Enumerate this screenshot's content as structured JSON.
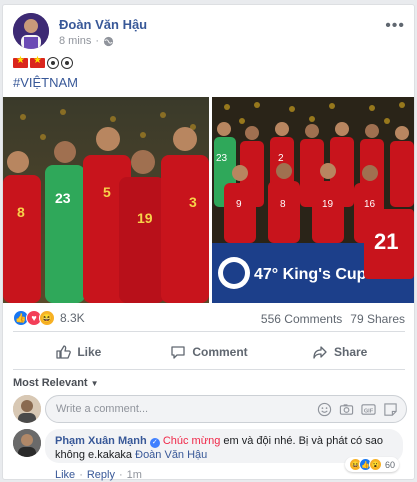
{
  "post": {
    "author": "Đoàn Văn Hậu",
    "time": "8 mins",
    "privacy_icon": "globe-icon",
    "hashtag": "#VIỆTNAM",
    "emoji_line": [
      "vietnam-flag",
      "vietnam-flag",
      "soccer-ball",
      "soccer-ball"
    ]
  },
  "photos": {
    "left_numbers": [
      "8",
      "23",
      "5",
      "19",
      "3"
    ],
    "right_numbers": [
      "23",
      "2",
      "9",
      "8",
      "19",
      "16",
      "21"
    ],
    "banner_text": "47° King's Cup"
  },
  "stats": {
    "reactions": [
      "like",
      "love",
      "haha"
    ],
    "reaction_count": "8.3K",
    "comments": "556 Comments",
    "shares": "79 Shares"
  },
  "actions": {
    "like": "Like",
    "comment": "Comment",
    "share": "Share"
  },
  "comments_section": {
    "sort": "Most Relevant",
    "placeholder": "Write a comment...",
    "composer_icons": [
      "emoji-icon",
      "camera-icon",
      "gif-icon",
      "sticker-icon"
    ]
  },
  "comment": {
    "author": "Phạm Xuân Mạnh",
    "highlight": "Chúc mừng",
    "text": " em và đội nhé. Bị và phát có sao không e.kakaka ",
    "tag": "Đoàn Văn Hậu",
    "reaction_count": "60",
    "like": "Like",
    "reply": "Reply",
    "time": "1m"
  },
  "colors": {
    "link": "#385898",
    "accent_red": "#f02849",
    "like_blue": "#1877f2"
  }
}
